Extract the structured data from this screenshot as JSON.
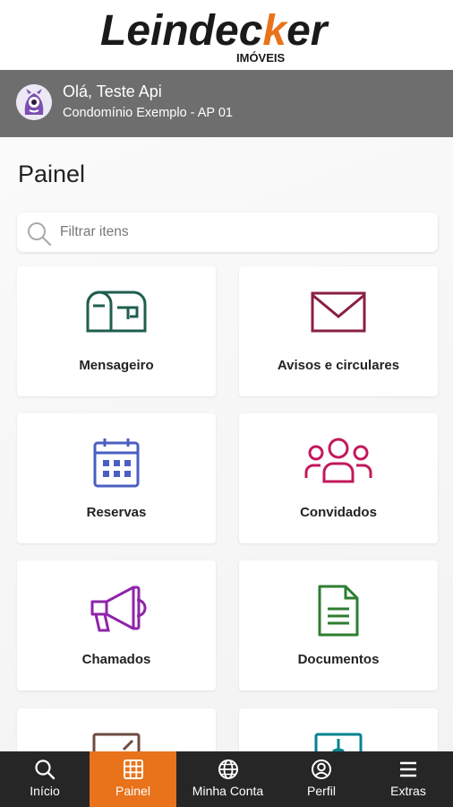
{
  "brand": {
    "name_part1": "Leindec",
    "name_part2": "k",
    "name_part3": "er",
    "tagline": "IMÓVEIS",
    "accent": "#e8731b"
  },
  "user": {
    "greeting": "Olá, Teste Api",
    "unit": "Condomínio Exemplo - AP 01"
  },
  "page": {
    "title": "Painel"
  },
  "search": {
    "placeholder": "Filtrar itens",
    "value": ""
  },
  "cards": [
    {
      "label": "Mensageiro",
      "icon": "mailbox-icon",
      "color": "#1f5e4e"
    },
    {
      "label": "Avisos e circulares",
      "icon": "envelope-icon",
      "color": "#8a1f45"
    },
    {
      "label": "Reservas",
      "icon": "calendar-icon",
      "color": "#4a5fc1"
    },
    {
      "label": "Convidados",
      "icon": "group-icon",
      "color": "#c2185b"
    },
    {
      "label": "Chamados",
      "icon": "megaphone-icon",
      "color": "#8e24aa"
    },
    {
      "label": "Documentos",
      "icon": "document-icon",
      "color": "#2e7d32"
    },
    {
      "label": "",
      "icon": "board-icon",
      "color": "#6d4c41"
    },
    {
      "label": "",
      "icon": "finance-icon",
      "color": "#00838f"
    }
  ],
  "nav": {
    "items": [
      {
        "label": "Início",
        "icon": "search-icon"
      },
      {
        "label": "Painel",
        "icon": "grid-icon",
        "active": true
      },
      {
        "label": "Minha Conta",
        "icon": "globe-icon"
      },
      {
        "label": "Perfil",
        "icon": "user-circle-icon"
      },
      {
        "label": "Extras",
        "icon": "menu-icon"
      }
    ]
  }
}
